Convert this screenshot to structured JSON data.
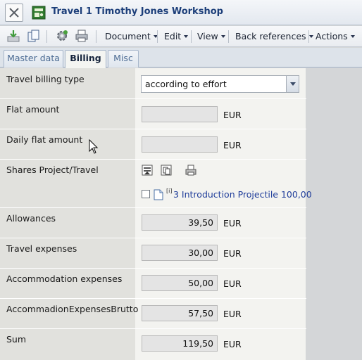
{
  "window": {
    "title": "Travel 1 Timothy Jones Workshop"
  },
  "toolbar": {
    "menus": [
      "Document",
      "Edit",
      "View",
      "Back references",
      "Actions"
    ]
  },
  "tabs": [
    {
      "label": "Master data",
      "active": false
    },
    {
      "label": "Billing",
      "active": true
    },
    {
      "label": "Misc",
      "active": false
    }
  ],
  "form": {
    "billing_type": {
      "label": "Travel billing type",
      "value": "according to effort"
    },
    "flat_amount": {
      "label": "Flat amount",
      "value": "",
      "unit": "EUR"
    },
    "daily_flat_amount": {
      "label": "Daily flat amount",
      "value": "",
      "unit": "EUR"
    },
    "shares": {
      "label": "Shares Project/Travel",
      "sup": "[i]",
      "item": "3 Introduction Projectile 100,00"
    },
    "allowances": {
      "label": "Allowances",
      "value": "39,50",
      "unit": "EUR"
    },
    "travel_expenses": {
      "label": "Travel expenses",
      "value": "30,00",
      "unit": "EUR"
    },
    "accommodation_expenses": {
      "label": "Accommodation expenses",
      "value": "50,00",
      "unit": "EUR"
    },
    "accommodation_brutto": {
      "label": "AccommadionExpensesBrutto",
      "value": "57,50",
      "unit": "EUR"
    },
    "sum": {
      "label": "Sum",
      "value": "119,50",
      "unit": "EUR"
    }
  },
  "colors": {
    "title_text": "#1d3f7a",
    "link": "#1f3d9a",
    "label_column": "#e1e1dd"
  }
}
